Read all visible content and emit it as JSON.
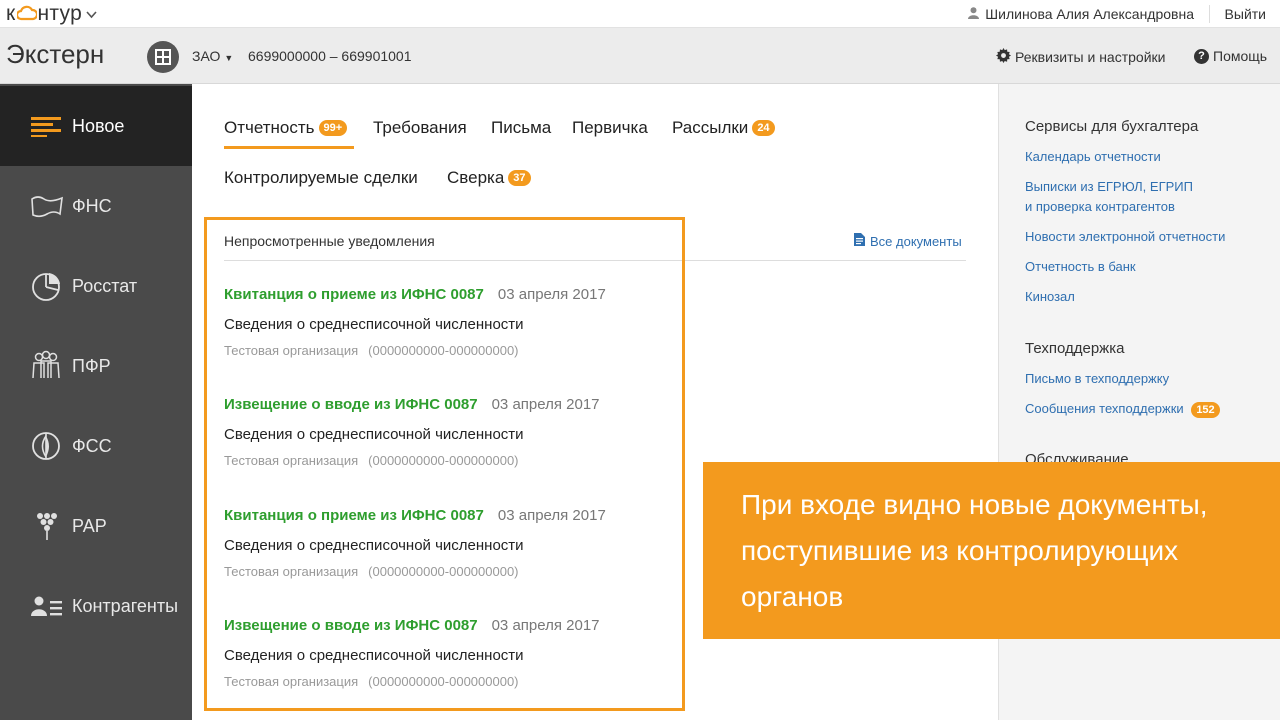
{
  "topbar": {
    "logo": {
      "pre": "к",
      "post": "нтур"
    },
    "user_name": "Шилинова Алия Александровна",
    "logout": "Выйти"
  },
  "appbar": {
    "app_name": "Экстерн",
    "org_type": "ЗАО",
    "org_inn_kpp": "6699000000 – 669901001",
    "settings": "Реквизиты и настройки",
    "help": "Помощь"
  },
  "sidebar": {
    "items": [
      {
        "label": "Новое",
        "icon": "list-lines-icon",
        "active": true
      },
      {
        "label": "ФНС",
        "icon": "map-icon"
      },
      {
        "label": "Росстат",
        "icon": "pie-chart-icon"
      },
      {
        "label": "ПФР",
        "icon": "people-icon"
      },
      {
        "label": "ФСС",
        "icon": "shield-icon"
      },
      {
        "label": "РАР",
        "icon": "grapes-icon"
      },
      {
        "label": "Контрагенты",
        "icon": "contacts-icon"
      }
    ]
  },
  "tabs": [
    {
      "label": "Отчетность",
      "badge": "99+"
    },
    {
      "label": "Требования"
    },
    {
      "label": "Письма"
    },
    {
      "label": "Первичка"
    },
    {
      "label": "Рассылки",
      "badge": "24"
    },
    {
      "label": "Контролируемые сделки"
    },
    {
      "label": "Сверка",
      "badge": "37"
    }
  ],
  "notifications": {
    "title": "Непросмотренные уведомления",
    "all_docs": "Все документы",
    "items": [
      {
        "title": "Квитанция о приеме из ИФНС 0087",
        "date": "03 апреля 2017",
        "subject": "Сведения о среднесписочной численности",
        "org": "Тестовая организация",
        "inn": "(0000000000-000000000)"
      },
      {
        "title": "Извещение о вводе из ИФНС 0087",
        "date": "03 апреля 2017",
        "subject": "Сведения о среднесписочной численности",
        "org": "Тестовая организация",
        "inn": "(0000000000-000000000)"
      },
      {
        "title": "Квитанция о приеме из ИФНС 0087",
        "date": "03 апреля 2017",
        "subject": "Сведения о среднесписочной численности",
        "org": "Тестовая организация",
        "inn": "(0000000000-000000000)"
      },
      {
        "title": "Извещение о вводе из ИФНС 0087",
        "date": "03 апреля 2017",
        "subject": "Сведения о среднесписочной численности",
        "org": "Тестовая организация",
        "inn": "(0000000000-000000000)"
      }
    ]
  },
  "right": {
    "services_title": "Сервисы для бухгалтера",
    "services": [
      "Календарь отчетности",
      "Выписки из ЕГРЮЛ, ЕГРИП",
      "и проверка контрагентов",
      "Новости электронной отчетности",
      "Отчетность в банк",
      "Кинозал"
    ],
    "support_title": "Техподдержка",
    "support_links": [
      "Письмо в техподдержку",
      "Сообщения техподдержки"
    ],
    "support_badge": "152",
    "service_title": "Обслуживание"
  },
  "callout": {
    "text": "При входе видно новые документы, поступившие из контролирующих органов"
  },
  "colors": {
    "accent": "#f39a1e",
    "sidebar": "#4a4a4a",
    "sidebar_active": "#232323",
    "link": "#2f6fb0",
    "success": "#2e9e2e"
  }
}
